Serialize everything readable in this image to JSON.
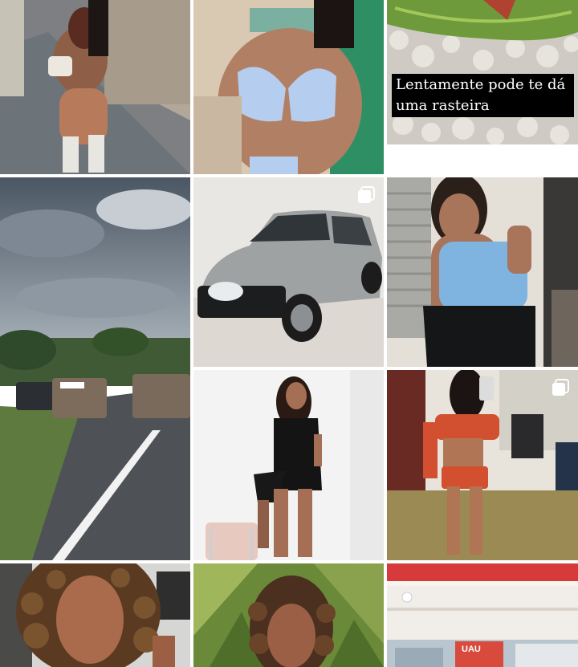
{
  "feed": {
    "tiles": [
      {
        "id": "t1",
        "alt": "woman in brown outfit and white boots on sidewalk",
        "multiple": false
      },
      {
        "id": "t2",
        "alt": "woman in light blue bikini on beach chair",
        "multiple": false
      },
      {
        "id": "t3",
        "alt": "venus flytrap over white stones",
        "multiple": false,
        "caption": "Lentamente pode te dá uma rasteira"
      },
      {
        "id": "t4",
        "alt": "road with police pickup trucks under cloudy sky",
        "multiple": false
      },
      {
        "id": "t5",
        "alt": "silver hatchback car in studio",
        "multiple": true
      },
      {
        "id": "t6",
        "alt": "woman in blue crop top and black skirt",
        "multiple": false
      },
      {
        "id": "t7",
        "alt": "woman in black strapless dress posing",
        "multiple": false
      },
      {
        "id": "t8",
        "alt": "woman in orange outfit taking mirror selfie",
        "multiple": true
      },
      {
        "id": "t9",
        "alt": "woman with curly hair close-up",
        "multiple": false
      },
      {
        "id": "t10",
        "alt": "woman with curly hair among palm leaves",
        "multiple": false
      },
      {
        "id": "t11",
        "alt": "store interior with red signage",
        "multiple": false,
        "sign": "UAU"
      }
    ]
  },
  "colors": {
    "background": "#ffffff",
    "caption_bg": "#000000",
    "caption_text": "#ffffff",
    "icon": "#ffffff"
  },
  "icons": {
    "multiple_posts": "carousel-icon"
  }
}
